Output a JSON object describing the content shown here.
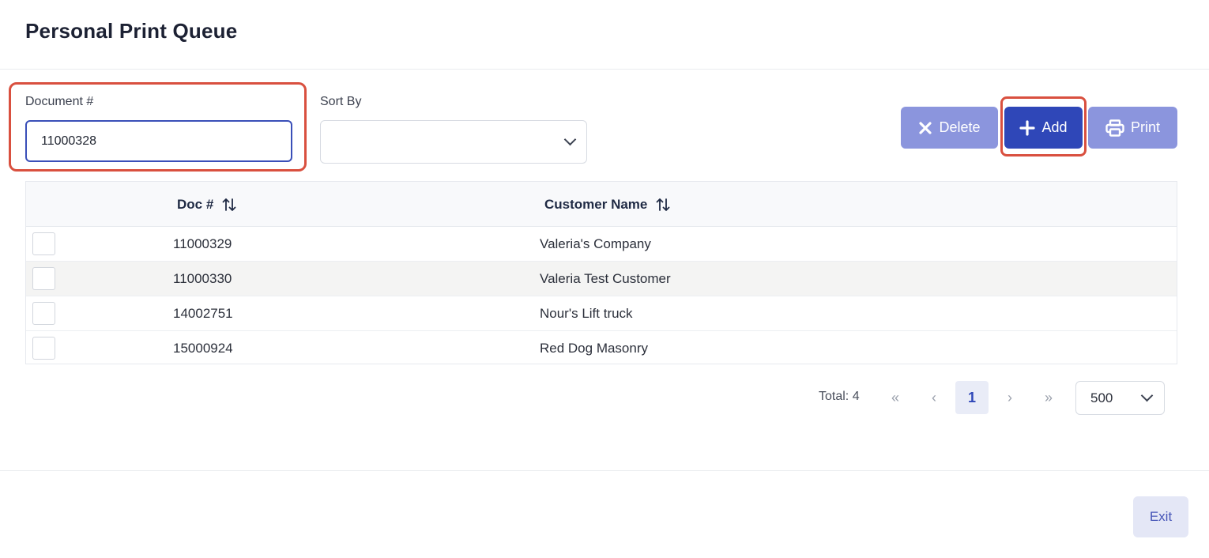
{
  "header": {
    "title": "Personal Print Queue"
  },
  "filters": {
    "document_label": "Document #",
    "document_value": "11000328",
    "sort_label": "Sort By",
    "sort_value": ""
  },
  "toolbar": {
    "delete_label": "Delete",
    "add_label": "Add",
    "print_label": "Print"
  },
  "table": {
    "columns": [
      "Doc #",
      "Customer Name"
    ],
    "rows": [
      {
        "doc": "11000329",
        "customer": "Valeria's Company"
      },
      {
        "doc": "11000330",
        "customer": "Valeria Test Customer"
      },
      {
        "doc": "14002751",
        "customer": "Nour's Lift truck"
      },
      {
        "doc": "15000924",
        "customer": "Red Dog Masonry"
      }
    ]
  },
  "pagination": {
    "total": "Total: 4",
    "current_page": "1",
    "page_size": "500",
    "first_glyph": "«",
    "prev_glyph": "‹",
    "next_glyph": "›",
    "last_glyph": "»"
  },
  "footer": {
    "exit_label": "Exit"
  },
  "icons": {
    "delete": "close-icon",
    "add": "plus-icon",
    "print": "printer-icon",
    "sort": "sort-icon",
    "dropdown": "chevron-down-icon"
  },
  "colors": {
    "primary": "#2f47b8",
    "primary_disabled": "#8b95dd",
    "highlight": "#d9503f"
  }
}
